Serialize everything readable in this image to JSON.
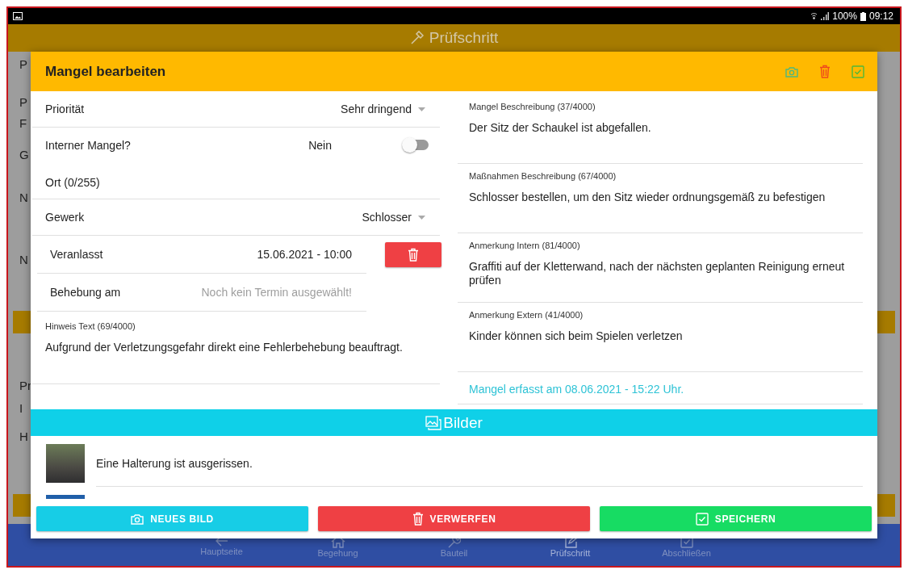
{
  "status_bar": {
    "battery": "100%",
    "time": "09:12"
  },
  "background": {
    "title": "Prüfschritt",
    "fragments": [
      "P",
      "P",
      "F",
      "G",
      "N",
      "N",
      "Pr",
      "I",
      "H"
    ],
    "nav": [
      {
        "kind": "back",
        "label": "Hauptseite",
        "selected": false
      },
      {
        "kind": "home",
        "label": "Begehung",
        "selected": false
      },
      {
        "kind": "wrench",
        "label": "Bauteil",
        "selected": false
      },
      {
        "kind": "edit",
        "label": "Prüfschritt",
        "selected": true
      },
      {
        "kind": "check",
        "label": "Abschließen",
        "selected": false
      }
    ]
  },
  "dialog": {
    "title": "Mangel bearbeiten",
    "left_fields": [
      {
        "kind": "dropdown",
        "label": "Priorität",
        "value": "Sehr dringend"
      },
      {
        "kind": "toggle",
        "label": "Interner Mangel?",
        "value": "Nein",
        "on": false
      },
      {
        "kind": "text",
        "label": "Ort (0/255)"
      },
      {
        "kind": "dropdown",
        "label": "Gewerk",
        "value": "Schlosser"
      },
      {
        "kind": "date",
        "label": "Veranlasst",
        "value": "15.06.2021 - 10:00",
        "deletable": true
      },
      {
        "kind": "date",
        "label": "Behebung am",
        "placeholder": "Noch kein Termin ausgewählt!",
        "deletable": false
      }
    ],
    "hint": {
      "label": "Hinweis Text (69/4000)",
      "value": "Aufgrund der Verletzungsgefahr direkt eine Fehlerbehebung beauftragt."
    },
    "right_fields": [
      {
        "label": "Mangel Beschreibung (37/4000)",
        "value": "Der Sitz der Schaukel ist abgefallen."
      },
      {
        "label": "Maßnahmen Beschreibung (67/4000)",
        "value": "Schlosser bestellen, um den Sitz wieder ordnungsgemäß zu befestigen"
      },
      {
        "label": "Anmerkung Intern (81/4000)",
        "value": "Graffiti auf der Kletterwand, nach der nächsten geplanten Reinigung erneut prüfen"
      },
      {
        "label": "Anmerkung Extern (41/4000)",
        "value": "Kinder können sich beim Spielen verletzen"
      }
    ],
    "recorded": "Mangel erfasst am 08.06.2021 - 15:22 Uhr.",
    "images_title": "Bilder",
    "images": [
      {
        "kind": "photo",
        "caption": "Eine Halterung ist ausgerissen."
      },
      {
        "kind": "photo"
      }
    ],
    "buttons": [
      {
        "kind": "camera",
        "label": "NEUES BILD",
        "color": "#17cde6"
      },
      {
        "kind": "trash",
        "label": "VERWERFEN",
        "color": "#ef4044"
      },
      {
        "kind": "check",
        "label": "SPEICHERN",
        "color": "#17dc63"
      }
    ]
  }
}
